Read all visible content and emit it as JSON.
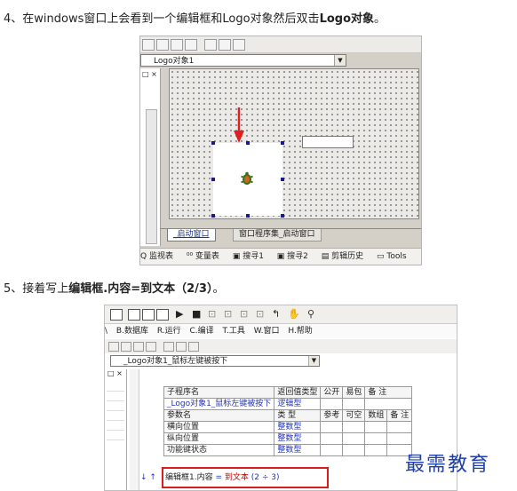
{
  "step4": {
    "number": "4、",
    "text": "在windows窗口上会看到一个编辑框和Logo对象然后双击",
    "bold": "Logo对象",
    "end": "。"
  },
  "step5": {
    "number": "5、",
    "text": "接着写上",
    "bold": "编辑框.内容=到文本（2/3）",
    "end": "。"
  },
  "shot1": {
    "combo_value": "Logo对象1",
    "tabs": [
      "_启动窗口",
      "窗口程序集_启动窗口"
    ],
    "status_items": [
      "监视表",
      "变量表",
      "搜寻1",
      "搜寻2",
      "剪辑历史",
      "Tools"
    ],
    "colors": {
      "arrow": "#e02020",
      "handle": "#1a1a8c",
      "highlight": "#d91d1d"
    }
  },
  "shot2": {
    "menu_items": [
      "B.数据库",
      "R.运行",
      "C.编译",
      "T.工具",
      "W.窗口",
      "H.帮助"
    ],
    "combo_value": "_Logo对象1_鼠标左键被按下",
    "table": {
      "header1": [
        "子程序名",
        "返回值类型",
        "公开",
        "易包",
        "备 注"
      ],
      "row1": [
        "_Logo对象1_鼠标左键被按下",
        "逻辑型",
        "",
        "",
        ""
      ],
      "header2": [
        "参数名",
        "类 型",
        "参考",
        "可空",
        "数组",
        "备 注"
      ],
      "params": [
        [
          "横向位置",
          "整数型",
          "",
          "",
          "",
          ""
        ],
        [
          "纵向位置",
          "整数型",
          "",
          "",
          "",
          ""
        ],
        [
          "功能键状态",
          "整数型",
          "",
          "",
          "",
          ""
        ]
      ]
    },
    "code": {
      "left": "编辑框1.内容",
      "op": "=",
      "func": "到文本",
      "args": "(2 ÷ 3)"
    },
    "arrows": "↓ ↑"
  },
  "watermark": "最需教育"
}
